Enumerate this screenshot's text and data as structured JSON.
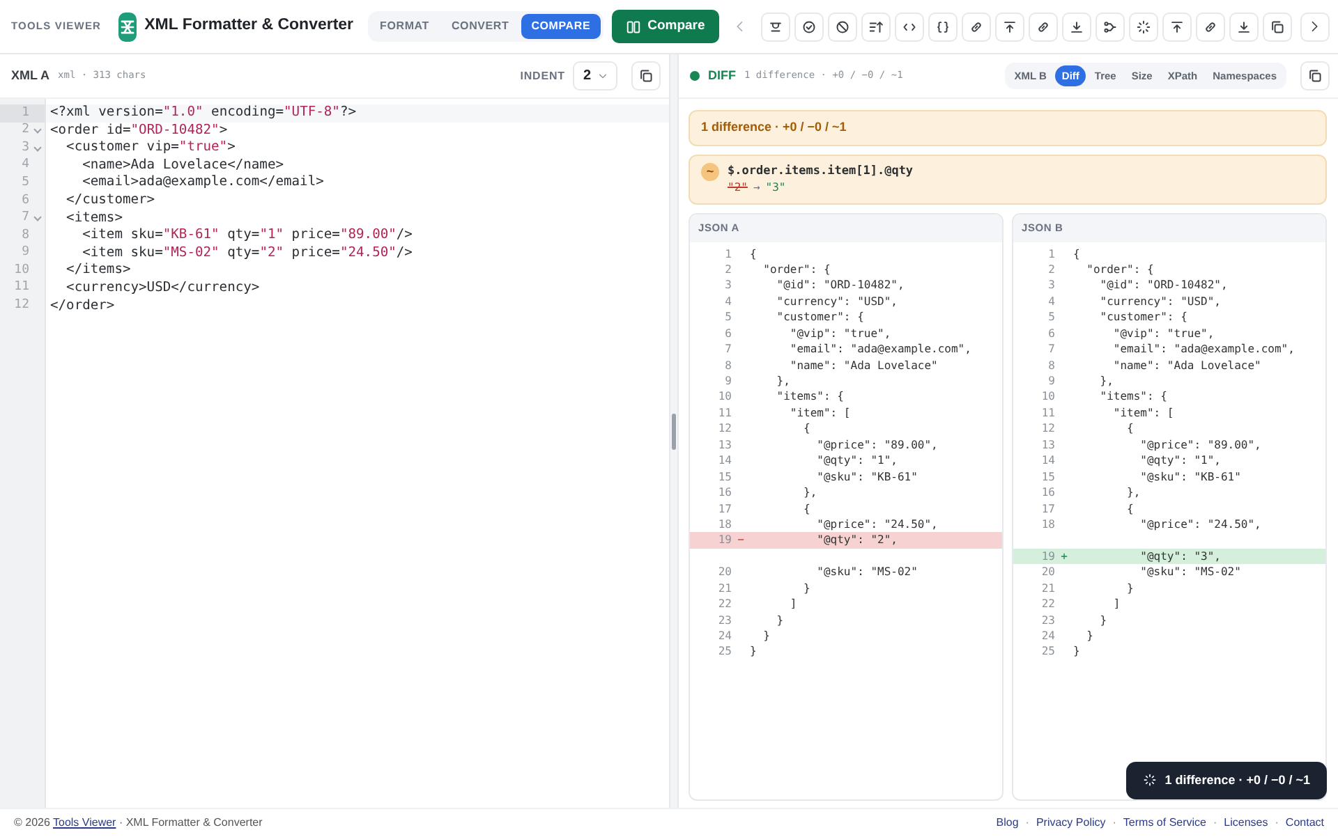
{
  "topbar": {
    "brand": "TOOLS VIEWER",
    "title": "XML Formatter & Converter",
    "modes": [
      {
        "label": "FORMAT",
        "selected": false
      },
      {
        "label": "CONVERT",
        "selected": false
      },
      {
        "label": "COMPARE",
        "selected": true
      }
    ],
    "action": "Compare"
  },
  "left_pane": {
    "title": "XML A",
    "meta": "xml · 313 chars",
    "indent_label": "INDENT",
    "indent_value": "2",
    "lines": [
      {
        "no": "1",
        "text": "<?xml version=\"1.0\" encoding=\"UTF-8\"?>",
        "active": true,
        "foldable": false
      },
      {
        "no": "2",
        "text": "<order id=\"ORD-10482\">",
        "active": false,
        "foldable": true
      },
      {
        "no": "3",
        "text": "  <customer vip=\"true\">",
        "active": false,
        "foldable": true
      },
      {
        "no": "4",
        "text": "    <name>Ada Lovelace</name>",
        "active": false,
        "foldable": false
      },
      {
        "no": "5",
        "text": "    <email>ada@example.com</email>",
        "active": false,
        "foldable": false
      },
      {
        "no": "6",
        "text": "  </customer>",
        "active": false,
        "foldable": false
      },
      {
        "no": "7",
        "text": "  <items>",
        "active": false,
        "foldable": true
      },
      {
        "no": "8",
        "text": "    <item sku=\"KB-61\" qty=\"1\" price=\"89.00\"/>",
        "active": false,
        "foldable": false
      },
      {
        "no": "9",
        "text": "    <item sku=\"MS-02\" qty=\"2\" price=\"24.50\"/>",
        "active": false,
        "foldable": false
      },
      {
        "no": "10",
        "text": "  </items>",
        "active": false,
        "foldable": false
      },
      {
        "no": "11",
        "text": "  <currency>USD</currency>",
        "active": false,
        "foldable": false
      },
      {
        "no": "12",
        "text": "</order>",
        "active": false,
        "foldable": false
      }
    ]
  },
  "right_pane": {
    "status": "DIFF",
    "meta": "1 difference · +0 / −0 / ~1",
    "tabs": [
      {
        "label": "XML B",
        "selected": false
      },
      {
        "label": "Diff",
        "selected": true
      },
      {
        "label": "Tree",
        "selected": false
      },
      {
        "label": "Size",
        "selected": false
      },
      {
        "label": "XPath",
        "selected": false
      },
      {
        "label": "Namespaces",
        "selected": false
      }
    ],
    "summary": "1 difference · +0 / −0 / ~1",
    "changes": [
      {
        "badge": "~",
        "path": "$.order.items.item[1].@qty",
        "old": "\"2\"",
        "arrow": "→",
        "new": "\"3\""
      }
    ],
    "columns": [
      {
        "title": "JSON A",
        "lines": [
          {
            "kind": "context",
            "no": "1",
            "text": "{"
          },
          {
            "kind": "context",
            "no": "2",
            "text": "  \"order\": {"
          },
          {
            "kind": "context",
            "no": "3",
            "text": "    \"@id\": \"ORD-10482\","
          },
          {
            "kind": "context",
            "no": "4",
            "text": "    \"currency\": \"USD\","
          },
          {
            "kind": "context",
            "no": "5",
            "text": "    \"customer\": {"
          },
          {
            "kind": "context",
            "no": "6",
            "text": "      \"@vip\": \"true\","
          },
          {
            "kind": "context",
            "no": "7",
            "text": "      \"email\": \"ada@example.com\","
          },
          {
            "kind": "context",
            "no": "8",
            "text": "      \"name\": \"Ada Lovelace\""
          },
          {
            "kind": "context",
            "no": "9",
            "text": "    },"
          },
          {
            "kind": "context",
            "no": "10",
            "text": "    \"items\": {"
          },
          {
            "kind": "context",
            "no": "11",
            "text": "      \"item\": ["
          },
          {
            "kind": "context",
            "no": "12",
            "text": "        {"
          },
          {
            "kind": "context",
            "no": "13",
            "text": "          \"@price\": \"89.00\","
          },
          {
            "kind": "context",
            "no": "14",
            "text": "          \"@qty\": \"1\","
          },
          {
            "kind": "context",
            "no": "15",
            "text": "          \"@sku\": \"KB-61\""
          },
          {
            "kind": "context",
            "no": "16",
            "text": "        },"
          },
          {
            "kind": "context",
            "no": "17",
            "text": "        {"
          },
          {
            "kind": "context",
            "no": "18",
            "text": "          \"@price\": \"24.50\","
          },
          {
            "kind": "removed",
            "no": "19",
            "marker": "−",
            "text": "          \"@qty\": \"2\","
          },
          {
            "kind": "spacer"
          },
          {
            "kind": "context",
            "no": "20",
            "text": "          \"@sku\": \"MS-02\""
          },
          {
            "kind": "context",
            "no": "21",
            "text": "        }"
          },
          {
            "kind": "context",
            "no": "22",
            "text": "      ]"
          },
          {
            "kind": "context",
            "no": "23",
            "text": "    }"
          },
          {
            "kind": "context",
            "no": "24",
            "text": "  }"
          },
          {
            "kind": "context",
            "no": "25",
            "text": "}"
          }
        ]
      },
      {
        "title": "JSON B",
        "lines": [
          {
            "kind": "context",
            "no": "1",
            "text": "{"
          },
          {
            "kind": "context",
            "no": "2",
            "text": "  \"order\": {"
          },
          {
            "kind": "context",
            "no": "3",
            "text": "    \"@id\": \"ORD-10482\","
          },
          {
            "kind": "context",
            "no": "4",
            "text": "    \"currency\": \"USD\","
          },
          {
            "kind": "context",
            "no": "5",
            "text": "    \"customer\": {"
          },
          {
            "kind": "context",
            "no": "6",
            "text": "      \"@vip\": \"true\","
          },
          {
            "kind": "context",
            "no": "7",
            "text": "      \"email\": \"ada@example.com\","
          },
          {
            "kind": "context",
            "no": "8",
            "text": "      \"name\": \"Ada Lovelace\""
          },
          {
            "kind": "context",
            "no": "9",
            "text": "    },"
          },
          {
            "kind": "context",
            "no": "10",
            "text": "    \"items\": {"
          },
          {
            "kind": "context",
            "no": "11",
            "text": "      \"item\": ["
          },
          {
            "kind": "context",
            "no": "12",
            "text": "        {"
          },
          {
            "kind": "context",
            "no": "13",
            "text": "          \"@price\": \"89.00\","
          },
          {
            "kind": "context",
            "no": "14",
            "text": "          \"@qty\": \"1\","
          },
          {
            "kind": "context",
            "no": "15",
            "text": "          \"@sku\": \"KB-61\""
          },
          {
            "kind": "context",
            "no": "16",
            "text": "        },"
          },
          {
            "kind": "context",
            "no": "17",
            "text": "        {"
          },
          {
            "kind": "context",
            "no": "18",
            "text": "          \"@price\": \"24.50\","
          },
          {
            "kind": "spacer"
          },
          {
            "kind": "added",
            "no": "19",
            "marker": "+",
            "text": "          \"@qty\": \"3\","
          },
          {
            "kind": "context",
            "no": "20",
            "text": "          \"@sku\": \"MS-02\""
          },
          {
            "kind": "context",
            "no": "21",
            "text": "        }"
          },
          {
            "kind": "context",
            "no": "22",
            "text": "      ]"
          },
          {
            "kind": "context",
            "no": "23",
            "text": "    }"
          },
          {
            "kind": "context",
            "no": "24",
            "text": "  }"
          },
          {
            "kind": "context",
            "no": "25",
            "text": "}"
          }
        ]
      }
    ]
  },
  "footer": {
    "copyright": "© 2026",
    "site_link": "Tools Viewer",
    "tail": "· XML Formatter & Converter",
    "separator": "·",
    "links": [
      "Blog",
      "Privacy Policy",
      "Terms of Service",
      "Licenses",
      "Contact"
    ]
  },
  "toast": {
    "text": "1 difference · +0 / −0 / ~1"
  }
}
